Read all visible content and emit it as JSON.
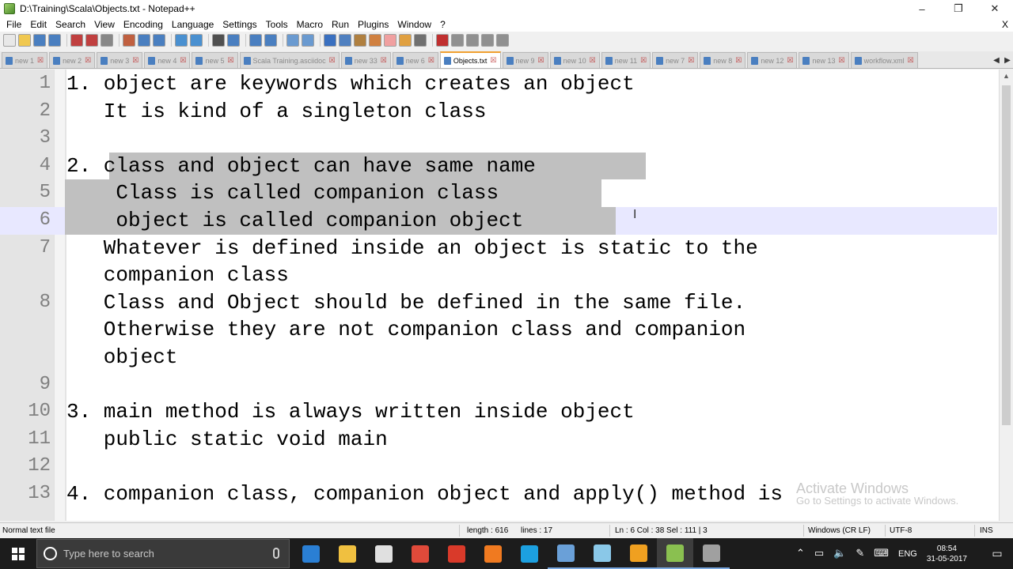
{
  "window": {
    "title": "D:\\Training\\Scala\\Objects.txt - Notepad++",
    "minimize_glyph": "–",
    "restore_glyph": "❐",
    "close_glyph": "✕"
  },
  "menu": {
    "items": [
      "File",
      "Edit",
      "Search",
      "View",
      "Encoding",
      "Language",
      "Settings",
      "Tools",
      "Macro",
      "Run",
      "Plugins",
      "Window",
      "?"
    ],
    "close_glyph": "X"
  },
  "toolbar": {
    "icons": [
      "new-file-icon",
      "open-file-icon",
      "save-icon",
      "save-all-icon",
      "close-icon",
      "close-all-icon",
      "print-icon",
      "cut-icon",
      "copy-icon",
      "paste-icon",
      "undo-icon",
      "redo-icon",
      "find-icon",
      "replace-icon",
      "zoom-in-icon",
      "zoom-out-icon",
      "sync-v-icon",
      "sync-h-icon",
      "wrap-icon",
      "all-chars-icon",
      "indent-guide-icon",
      "doc-map-icon",
      "function-list-icon",
      "folder-workspace-icon",
      "monitor-icon",
      "record-macro-icon",
      "stop-macro-icon",
      "play-macro-icon",
      "run-macro-icon",
      "save-macro-icon"
    ]
  },
  "tabs": [
    {
      "label": "new 1",
      "active": false
    },
    {
      "label": "new 2",
      "active": false
    },
    {
      "label": "new 3",
      "active": false
    },
    {
      "label": "new 4",
      "active": false
    },
    {
      "label": "new 5",
      "active": false
    },
    {
      "label": "Scala Training.asciidoc",
      "active": false
    },
    {
      "label": "new 33",
      "active": false
    },
    {
      "label": "new 6",
      "active": false
    },
    {
      "label": "Objects.txt",
      "active": true
    },
    {
      "label": "new 9",
      "active": false
    },
    {
      "label": "new 10",
      "active": false
    },
    {
      "label": "new 11",
      "active": false
    },
    {
      "label": "new 7",
      "active": false
    },
    {
      "label": "new 8",
      "active": false
    },
    {
      "label": "new 12",
      "active": false
    },
    {
      "label": "new 13",
      "active": false
    },
    {
      "label": "workflow.xml",
      "active": false
    }
  ],
  "editor": {
    "rows": [
      {
        "num": "1",
        "text": "1. object are keywords which creates an object"
      },
      {
        "num": "",
        "text": "   It is kind of a singleton class"
      },
      {
        "num": "3",
        "text": ""
      },
      {
        "num": "4",
        "text": "2. class and object can have same name"
      },
      {
        "num": "5",
        "text": "    Class is called companion class"
      },
      {
        "num": "6",
        "text": "    object is called companion object"
      },
      {
        "num": "7",
        "text": "   Whatever is defined inside an object is static to the"
      },
      {
        "num": "",
        "text": "   companion class"
      },
      {
        "num": "8",
        "text": "   Class and Object should be defined in the same file."
      },
      {
        "num": "",
        "text": "   Otherwise they are not companion class and companion"
      },
      {
        "num": "",
        "text": "   object"
      },
      {
        "num": "9",
        "text": ""
      },
      {
        "num": "10",
        "text": "3. main method is always written inside object"
      },
      {
        "num": "11",
        "text": "   public static void main"
      },
      {
        "num": "12",
        "text": ""
      },
      {
        "num": "13",
        "text": "4. companion class, companion object and apply() method is"
      }
    ],
    "row_2_num": "2",
    "watermark_title": "Activate Windows",
    "watermark_sub": "Go to Settings to activate Windows."
  },
  "status": {
    "file_type": "Normal text file",
    "length": "length : 616",
    "lines": "lines : 17",
    "position": "Ln : 6    Col : 38    Sel : 111 | 3",
    "eol": "Windows (CR LF)",
    "encoding": "UTF-8",
    "mode": "INS"
  },
  "taskbar": {
    "search_placeholder": "Type here to search",
    "apps": [
      {
        "name": "edge-icon",
        "color": "#2a7fd4"
      },
      {
        "name": "file-explorer-icon",
        "color": "#f0c040"
      },
      {
        "name": "store-icon",
        "color": "#e0e0e0"
      },
      {
        "name": "chrome-icon",
        "color": "#e04a3a"
      },
      {
        "name": "snagit-icon",
        "color": "#d93a2a"
      },
      {
        "name": "firefox-icon",
        "color": "#f07a20"
      },
      {
        "name": "skype-icon",
        "color": "#1ca0e0"
      },
      {
        "name": "virtualbox-icon",
        "color": "#6aa0d8"
      },
      {
        "name": "notepad-icon",
        "color": "#8ac8e8"
      },
      {
        "name": "paint-icon",
        "color": "#f0a020"
      },
      {
        "name": "notepadpp-icon",
        "color": "#8ac050"
      },
      {
        "name": "tools-icon",
        "color": "#a0a0a0"
      }
    ],
    "language": "ENG",
    "time": "08:54",
    "date": "31-05-2017"
  }
}
